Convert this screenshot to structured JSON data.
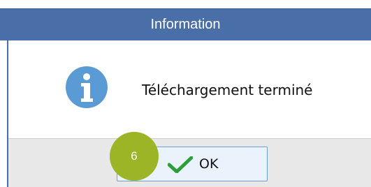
{
  "dialog": {
    "title": "Information",
    "message": "Téléchargement terminé",
    "icon": "info-icon"
  },
  "footer": {
    "ok_label": "OK",
    "ok_icon": "checkmark-icon"
  },
  "annotation": {
    "step_number": "6"
  },
  "colors": {
    "titlebar": "#4a6ea8",
    "info_icon": "#5b9bd5",
    "checkmark": "#2e9e3a",
    "badge": "#9cb527",
    "button_bg": "#eaf3fb",
    "button_border": "#6f9fd2"
  }
}
